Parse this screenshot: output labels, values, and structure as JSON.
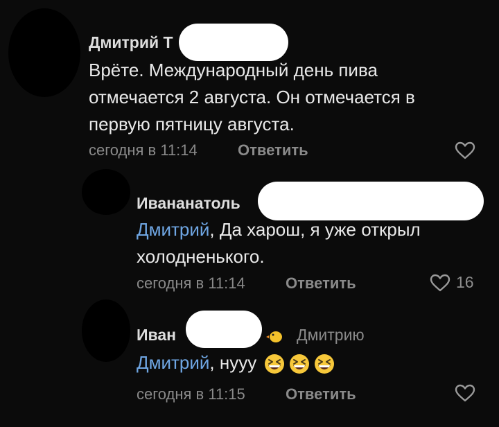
{
  "comments": [
    {
      "author": "Дмитрий Т",
      "text": "Врёте. Международный день пива отмечается 2 августа. Он отмечается в первую пятницу августа.",
      "lines": [
        "Врёте. Международный день пива",
        "отмечается 2 августа. Он отмечается в",
        "первую пятницу августа."
      ],
      "time": "сегодня в 11:14",
      "reply_label": "Ответить",
      "likes": ""
    },
    {
      "author": "Ивананатоль",
      "mention": "Дмитрий",
      "line1_rest": ", Да харош, я уже открыл",
      "line2": "холодненького.",
      "time": "сегодня в 11:14",
      "reply_label": "Ответить",
      "likes": "16"
    },
    {
      "author": "Иван",
      "reply_to": "Дмитрию",
      "mention": "Дмитрий",
      "text_rest": ", нууу",
      "emoji": [
        "grinning-squinting-face",
        "grinning-squinting-face",
        "grinning-squinting-face"
      ],
      "time": "сегодня в 11:15",
      "reply_label": "Ответить",
      "likes": ""
    }
  ],
  "colors": {
    "background": "#0b0b0b",
    "mention": "#6fa6e3",
    "meta": "#8a8a8a",
    "text": "#e9e9e9"
  }
}
